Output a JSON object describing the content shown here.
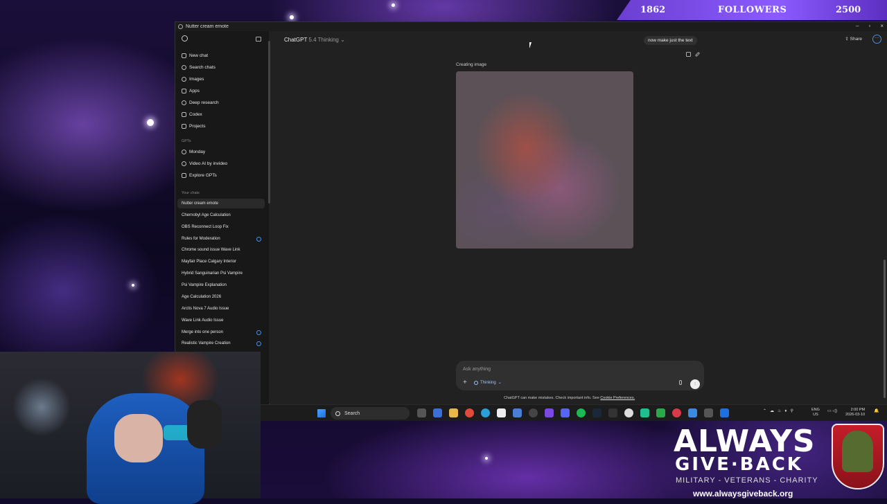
{
  "overlay": {
    "followers_current": "1862",
    "followers_label": "FOLLOWERS",
    "followers_goal": "2500"
  },
  "window": {
    "title": "Nutter cream emote",
    "controls": [
      "–",
      "▫",
      "×"
    ]
  },
  "sidebar": {
    "items": [
      {
        "label": "New chat",
        "icon": "new-chat-icon"
      },
      {
        "label": "Search chats",
        "icon": "search-icon"
      },
      {
        "label": "Images",
        "icon": "images-icon"
      },
      {
        "label": "Apps",
        "icon": "apps-icon"
      },
      {
        "label": "Deep research",
        "icon": "deep-research-icon"
      },
      {
        "label": "Codex",
        "icon": "codex-icon"
      },
      {
        "label": "Projects",
        "icon": "folder-icon"
      }
    ],
    "gpts_heading": "GPTs",
    "gpts": [
      {
        "label": "Monday"
      },
      {
        "label": "Video AI by invideo"
      },
      {
        "label": "Explore GPTs"
      }
    ],
    "chats_heading": "Your chats",
    "chats": [
      {
        "label": "Nutter cream emote",
        "active": true
      },
      {
        "label": "Chernobyl Age Calculation"
      },
      {
        "label": "OBS Reconnect Loop Fix"
      },
      {
        "label": "Rules for Moderation",
        "badge": true
      },
      {
        "label": "Chrome sound issue Wave Link"
      },
      {
        "label": "Mayfair Place Calgary Interior"
      },
      {
        "label": "Hybrid Sanguinarian Psi Vampire"
      },
      {
        "label": "Psi Vampire Explanation"
      },
      {
        "label": "Age Calculation 2026"
      },
      {
        "label": "Arctis Nova 7 Audio Issue"
      },
      {
        "label": "Wave Link Audio Issue"
      },
      {
        "label": "Merge into one person",
        "badge": true
      },
      {
        "label": "Realistic Vampire Creation",
        "badge": true
      }
    ]
  },
  "header": {
    "model": "ChatGPT",
    "model_mode": "5.4 Thinking",
    "share": "Share"
  },
  "conversation": {
    "user_message": "now make just the text",
    "status": "Creating image"
  },
  "composer": {
    "placeholder": "Ask anything",
    "mode": "Thinking",
    "disclaimer": "ChatGPT can make mistakes. Check important info. See",
    "disclaimer_link": "Cookie Preferences."
  },
  "taskbar": {
    "search": "Search",
    "lang_top": "ENG",
    "lang_bottom": "US",
    "time": "2:00 PM",
    "date": "2026-03-10"
  },
  "brand": {
    "line1": "ALWAYS",
    "line2": "GIVE·BACK",
    "line3": "MILITARY - VETERANS - CHARITY",
    "url": "www.alwaysgiveback.org"
  }
}
